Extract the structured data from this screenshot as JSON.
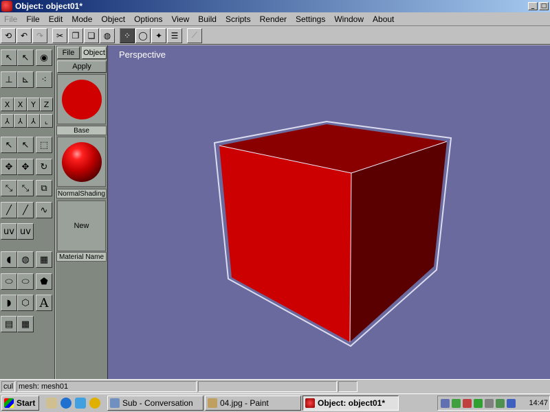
{
  "window": {
    "title": "Object: object01*",
    "controls": [
      "_",
      "□"
    ]
  },
  "menu": [
    {
      "label": "File",
      "disabled_prefix": "File"
    },
    {
      "label": "Edit"
    },
    {
      "label": "Mode"
    },
    {
      "label": "Object"
    },
    {
      "label": "Options"
    },
    {
      "label": "View"
    },
    {
      "label": "Build"
    },
    {
      "label": "Scripts"
    },
    {
      "label": "Render"
    },
    {
      "label": "Settings"
    },
    {
      "label": "Window"
    },
    {
      "label": "About"
    }
  ],
  "menu_disabled": "File",
  "toolbar": {
    "icons": [
      "rotate-left-icon",
      "undo-icon",
      "redo-icon",
      "cut-icon",
      "copy-icon",
      "paste-icon",
      "sphere-icon",
      "points-icon",
      "circle-icon",
      "transform-icon",
      "list-icon",
      "graph-icon"
    ]
  },
  "tool_labels": {
    "x": "X",
    "x2": "X",
    "y": "Y",
    "z": "Z",
    "uv": "uv",
    "uv2": "uv",
    "text": "A",
    "cul": "cul"
  },
  "material_panel": {
    "tab_file": "File",
    "tab_object": "Object",
    "apply": "Apply",
    "base_label": "Base",
    "shading_label": "NormalShading",
    "new_label": "New",
    "material_name_label": "Material Name"
  },
  "viewport": {
    "label": "Perspective",
    "background": "#6a6a9e",
    "cube_colors": {
      "front": "#cc0000",
      "top": "#8a0000",
      "side": "#5a0000"
    }
  },
  "statusbar": {
    "left": "cul",
    "mesh": "mesh: mesh01"
  },
  "taskbar": {
    "start": "Start",
    "tasks": [
      {
        "label": "Sub - Conversation"
      },
      {
        "label": "04.jpg - Paint"
      },
      {
        "label": "Object: object01*",
        "active": true
      }
    ],
    "clock": "14:47"
  }
}
